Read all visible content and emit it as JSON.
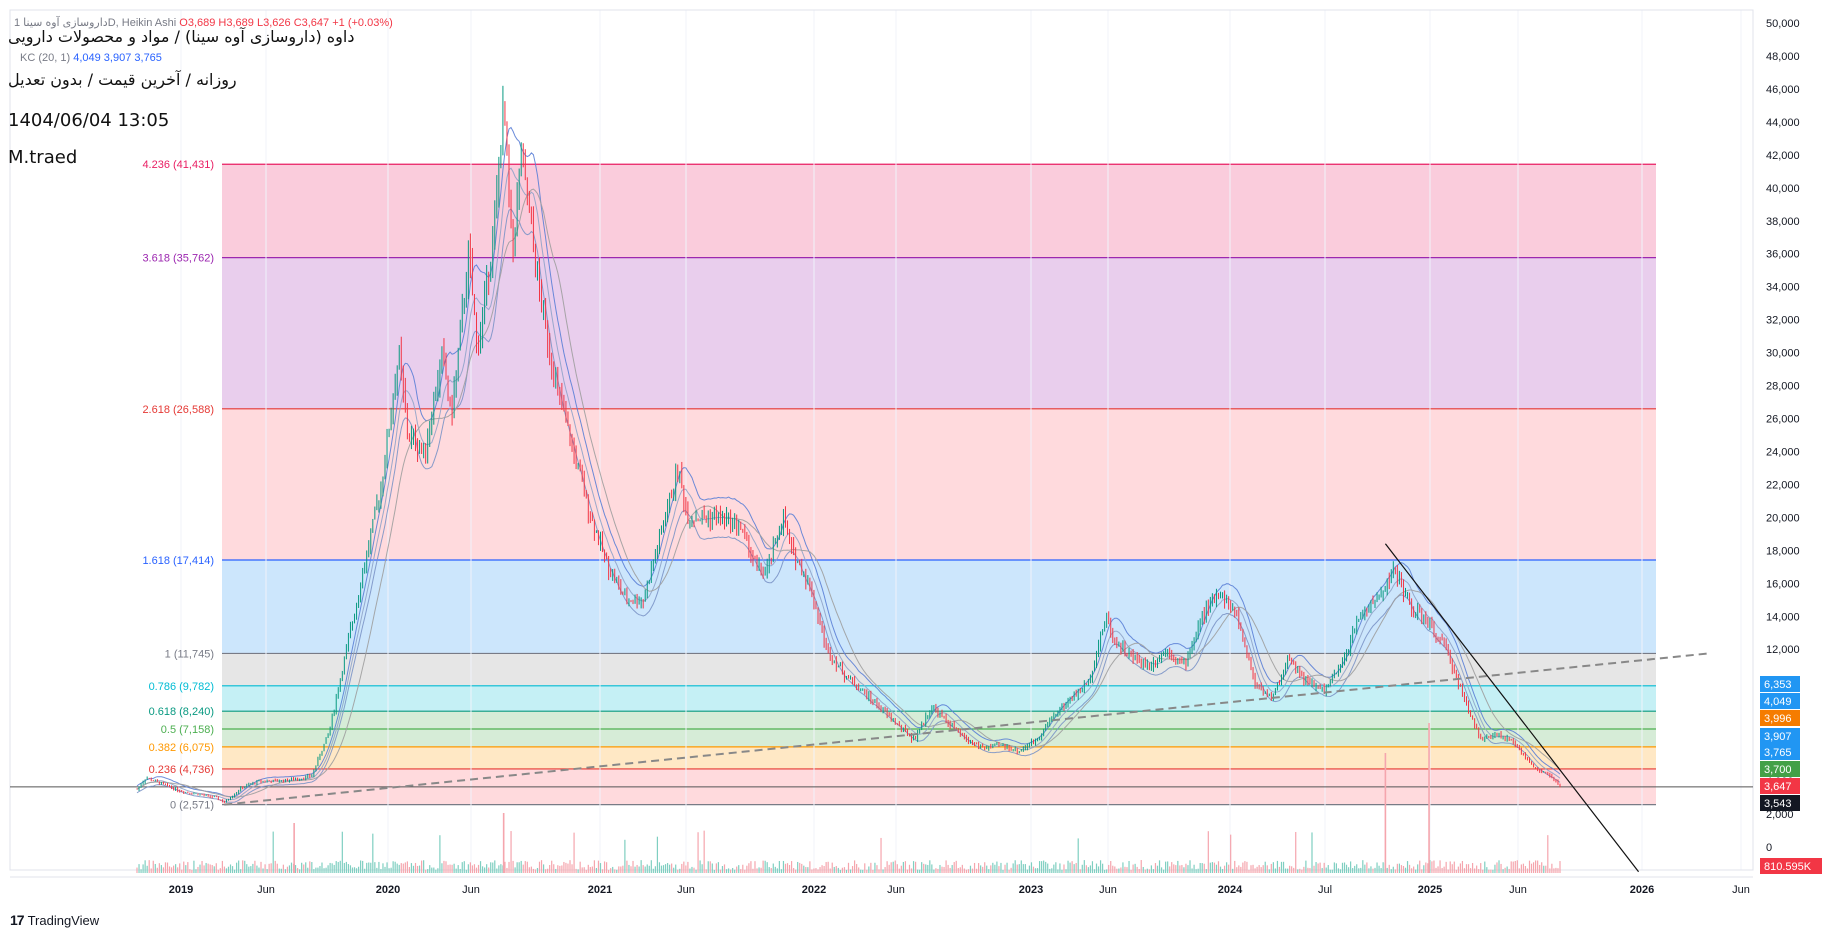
{
  "header": {
    "ohlc_symbol": "داروسازی آوه سینا 1D",
    "ohlc_style": "Heikin Ashi",
    "open": "O3,689",
    "high": "H3,689",
    "low": "L3,626",
    "close": "C3,647",
    "change": "+1 (+0.03%)",
    "kc_label": "KC (20, 1)",
    "kc_values": [
      "4,049",
      "3,907",
      "3,765"
    ],
    "title": "داوه (داروسازی آوه سینا) / مواد و محصولات دارویی",
    "subtitle": "روزانه / آخرین قیمت / بدون تعدیل",
    "datetime": "1404/06/04 13:05",
    "author": "M.traed"
  },
  "branding": {
    "logo_mark": "17",
    "logo_text": "TradingView"
  },
  "chart_data": {
    "type": "candlestick",
    "y_axis": {
      "min": 0,
      "max": 50000,
      "ticks": [
        "50,000",
        "48,000",
        "46,000",
        "44,000",
        "42,000",
        "40,000",
        "38,000",
        "36,000",
        "34,000",
        "32,000",
        "30,000",
        "28,000",
        "26,000",
        "24,000",
        "22,000",
        "20,000",
        "18,000",
        "16,000",
        "14,000",
        "12,000",
        "10,000",
        "8,000",
        "6,000",
        "4,000",
        "2,000",
        "0"
      ]
    },
    "x_axis": {
      "labels": [
        "2019",
        "Jun",
        "2020",
        "Jun",
        "2021",
        "Jun",
        "2022",
        "Jun",
        "2023",
        "Jun",
        "2024",
        "Jul",
        "2025",
        "Jun",
        "2026",
        "Jun"
      ]
    },
    "fib_levels": [
      {
        "label": "4.236 (41,431)",
        "value": 41431,
        "color": "#e91e63",
        "fill": "#f8bbd0"
      },
      {
        "label": "3.618 (35,762)",
        "value": 35762,
        "color": "#9c27b0",
        "fill": "#e1bee7"
      },
      {
        "label": "2.618 (26,588)",
        "value": 26588,
        "color": "#e53935",
        "fill": "#ffcdd2"
      },
      {
        "label": "1.618 (17,414)",
        "value": 17414,
        "color": "#2962ff",
        "fill": "#bbdefb"
      },
      {
        "label": "1 (11,745)",
        "value": 11745,
        "color": "#787b86",
        "fill": "#dddddd"
      },
      {
        "label": "0.786 (9,782)",
        "value": 9782,
        "color": "#00bcd4",
        "fill": "#b2ebf2"
      },
      {
        "label": "0.618 (8,240)",
        "value": 8240,
        "color": "#089981",
        "fill": "#c8e6c9"
      },
      {
        "label": "0.5 (7,158)",
        "value": 7158,
        "color": "#4caf50",
        "fill": "#c8e6c9"
      },
      {
        "label": "0.382 (6,075)",
        "value": 6075,
        "color": "#ff9800",
        "fill": "#ffe0b2"
      },
      {
        "label": "0.236 (4,736)",
        "value": 4736,
        "color": "#e53935",
        "fill": "#ffcdd2"
      },
      {
        "label": "0 (2,571)",
        "value": 2571,
        "color": "#787b86",
        "fill": "#ffcdd2"
      }
    ],
    "price_series": [
      [
        0.0,
        3500
      ],
      [
        0.01,
        4200
      ],
      [
        0.03,
        3800
      ],
      [
        0.05,
        3400
      ],
      [
        0.07,
        3200
      ],
      [
        0.09,
        3000
      ],
      [
        0.1,
        2700
      ],
      [
        0.12,
        3600
      ],
      [
        0.14,
        4000
      ],
      [
        0.16,
        4000
      ],
      [
        0.18,
        4100
      ],
      [
        0.2,
        4300
      ],
      [
        0.22,
        7000
      ],
      [
        0.24,
        12000
      ],
      [
        0.26,
        17000
      ],
      [
        0.28,
        22000
      ],
      [
        0.3,
        30000
      ],
      [
        0.31,
        25000
      ],
      [
        0.33,
        24000
      ],
      [
        0.35,
        30000
      ],
      [
        0.36,
        26000
      ],
      [
        0.38,
        36000
      ],
      [
        0.39,
        30000
      ],
      [
        0.41,
        38000
      ],
      [
        0.42,
        45000
      ],
      [
        0.43,
        36000
      ],
      [
        0.44,
        42000
      ],
      [
        0.45,
        38000
      ],
      [
        0.46,
        34000
      ],
      [
        0.48,
        28000
      ],
      [
        0.5,
        24000
      ],
      [
        0.52,
        20000
      ],
      [
        0.54,
        17000
      ],
      [
        0.56,
        15000
      ],
      [
        0.58,
        15000
      ],
      [
        0.6,
        19000
      ],
      [
        0.62,
        23000
      ],
      [
        0.63,
        20000
      ],
      [
        0.65,
        20000
      ],
      [
        0.67,
        20000
      ],
      [
        0.69,
        19500
      ],
      [
        0.71,
        17000
      ],
      [
        0.72,
        16500
      ],
      [
        0.74,
        20000
      ],
      [
        0.75,
        18000
      ],
      [
        0.77,
        16000
      ],
      [
        0.79,
        12000
      ],
      [
        0.81,
        10500
      ],
      [
        0.83,
        9500
      ],
      [
        0.85,
        8500
      ],
      [
        0.87,
        7500
      ],
      [
        0.89,
        6500
      ],
      [
        0.91,
        8500
      ],
      [
        0.93,
        7500
      ],
      [
        0.95,
        6500
      ],
      [
        0.97,
        6000
      ],
      [
        0.99,
        6200
      ],
      [
        1.01,
        5800
      ],
      [
        1.03,
        6500
      ],
      [
        1.05,
        8000
      ],
      [
        1.07,
        9000
      ],
      [
        1.09,
        10000
      ],
      [
        1.11,
        14000
      ],
      [
        1.12,
        12500
      ],
      [
        1.14,
        11500
      ],
      [
        1.16,
        11000
      ],
      [
        1.18,
        12000
      ],
      [
        1.2,
        11000
      ],
      [
        1.22,
        14000
      ],
      [
        1.24,
        15500
      ],
      [
        1.26,
        14000
      ],
      [
        1.28,
        10000
      ],
      [
        1.3,
        9000
      ],
      [
        1.32,
        11500
      ],
      [
        1.34,
        10000
      ],
      [
        1.36,
        9500
      ],
      [
        1.38,
        11000
      ],
      [
        1.4,
        14000
      ],
      [
        1.42,
        15000
      ],
      [
        1.44,
        16800
      ],
      [
        1.46,
        14500
      ],
      [
        1.48,
        13500
      ],
      [
        1.5,
        12000
      ],
      [
        1.52,
        9000
      ],
      [
        1.54,
        6500
      ],
      [
        1.56,
        6800
      ],
      [
        1.58,
        6200
      ],
      [
        1.6,
        4800
      ],
      [
        1.62,
        4300
      ],
      [
        1.63,
        3650
      ]
    ],
    "trendlines": [
      {
        "name": "",
        "style": "dashed",
        "points": [
          [
            0.1,
            2571
          ],
          [
            1.8,
            11745
          ]
        ]
      },
      {
        "name": "",
        "style": "solid",
        "points": [
          [
            1.43,
            18400
          ],
          [
            1.72,
            -1500
          ]
        ]
      }
    ],
    "volume": {
      "last_label": "810.595K"
    },
    "price_badges": [
      {
        "value": "6,353",
        "color": "#2196f3"
      },
      {
        "value": "4,049",
        "color": "#2196f3"
      },
      {
        "value": "3,996",
        "color": "#f57c00"
      },
      {
        "value": "3,907",
        "color": "#2196f3"
      },
      {
        "value": "3,765",
        "color": "#2196f3"
      },
      {
        "value": "3,700",
        "color": "#43a047"
      },
      {
        "value": "3,647",
        "color": "#f23645"
      },
      {
        "value": "3,543",
        "color": "#131722"
      }
    ]
  }
}
